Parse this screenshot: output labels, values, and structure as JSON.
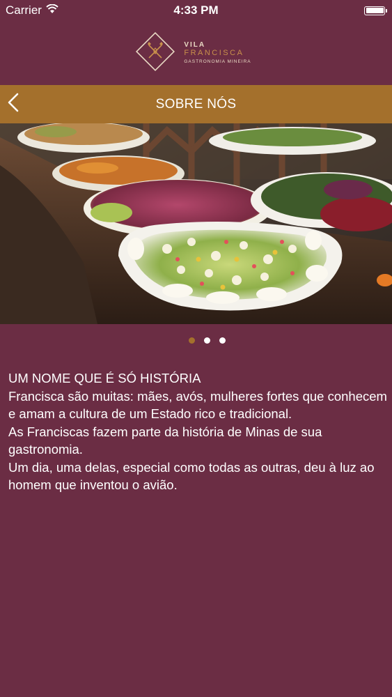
{
  "status_bar": {
    "carrier": "Carrier",
    "time": "4:33 PM"
  },
  "logo": {
    "line1": "VILA",
    "line2": "FRANCISCA",
    "line3": "GASTRONOMIA MINEIRA"
  },
  "navbar": {
    "title": "SOBRE NÓS",
    "back_icon": "chevron-left-icon"
  },
  "carousel": {
    "page_count": 3,
    "current_page": 1
  },
  "content": {
    "heading": "UM NOME QUE É SÓ HISTÓRIA",
    "paragraphs": [
      "Francisca são muitas: mães, avós, mulheres fortes que conhecem e amam a cultura de um Estado rico e tradicional.",
      "As Franciscas fazem parte da história de Minas de sua gastronomia.",
      "Um dia, uma delas, especial como todas as outras, deu à luz ao homem que inventou o avião."
    ]
  },
  "colors": {
    "background": "#6b2d44",
    "accent": "#a4702c",
    "text": "#ffffff"
  }
}
